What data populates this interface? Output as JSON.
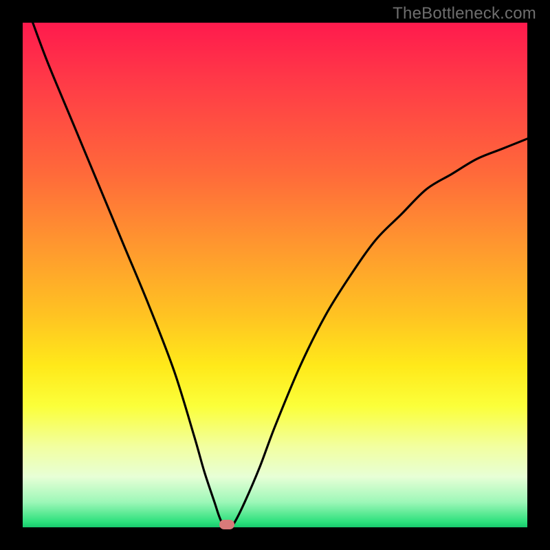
{
  "watermark": "TheBottleneck.com",
  "chart_data": {
    "type": "line",
    "title": "",
    "xlabel": "",
    "ylabel": "",
    "xlim": [
      0,
      100
    ],
    "ylim": [
      0,
      100
    ],
    "grid": false,
    "legend": false,
    "series": [
      {
        "name": "bottleneck-curve",
        "x": [
          2,
          5,
          10,
          15,
          20,
          25,
          30,
          34,
          36,
          38,
          39,
          40,
          41,
          42,
          44,
          47,
          50,
          55,
          60,
          65,
          70,
          75,
          80,
          85,
          90,
          95,
          100
        ],
        "y": [
          100,
          92,
          80,
          68,
          56,
          44,
          31,
          18,
          11,
          5,
          2,
          0,
          0,
          1,
          5,
          12,
          20,
          32,
          42,
          50,
          57,
          62,
          67,
          70,
          73,
          75,
          77
        ]
      }
    ],
    "marker": {
      "x": 40.5,
      "y": 0
    },
    "gradient_stops": [
      {
        "pct": 0,
        "color": "#ff1a4d"
      },
      {
        "pct": 30,
        "color": "#ff6a3a"
      },
      {
        "pct": 60,
        "color": "#ffe91a"
      },
      {
        "pct": 90,
        "color": "#e7ffd6"
      },
      {
        "pct": 100,
        "color": "#18c96e"
      }
    ]
  }
}
